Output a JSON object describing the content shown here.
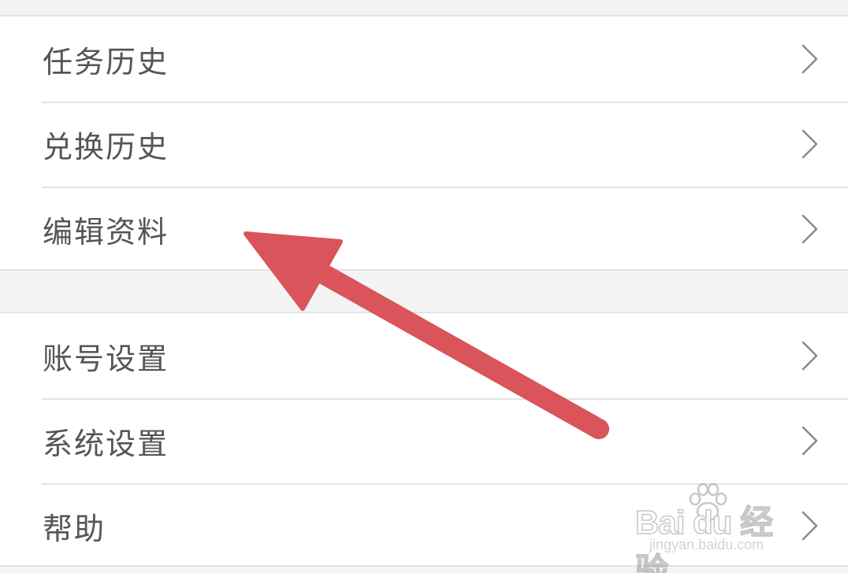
{
  "menu": {
    "group_1": [
      {
        "label": "任务历史",
        "icon": "chevron-right-icon"
      },
      {
        "label": "兑换历史",
        "icon": "chevron-right-icon"
      },
      {
        "label": "编辑资料",
        "icon": "chevron-right-icon"
      }
    ],
    "group_2": [
      {
        "label": "账号设置",
        "icon": "chevron-right-icon"
      },
      {
        "label": "系统设置",
        "icon": "chevron-right-icon"
      },
      {
        "label": "帮助",
        "icon": "chevron-right-icon"
      }
    ]
  },
  "annotation": {
    "type": "arrow",
    "color": "#d9545b",
    "points_to": "编辑资料"
  },
  "watermark": {
    "logo_text": "Bai du 经验",
    "url_text": "jingyan.baidu.com"
  },
  "colors": {
    "background": "#f4f4f4",
    "row_background": "#ffffff",
    "divider": "#e3e3e3",
    "label_text": "#555555",
    "chevron": "#8a8a8a"
  }
}
